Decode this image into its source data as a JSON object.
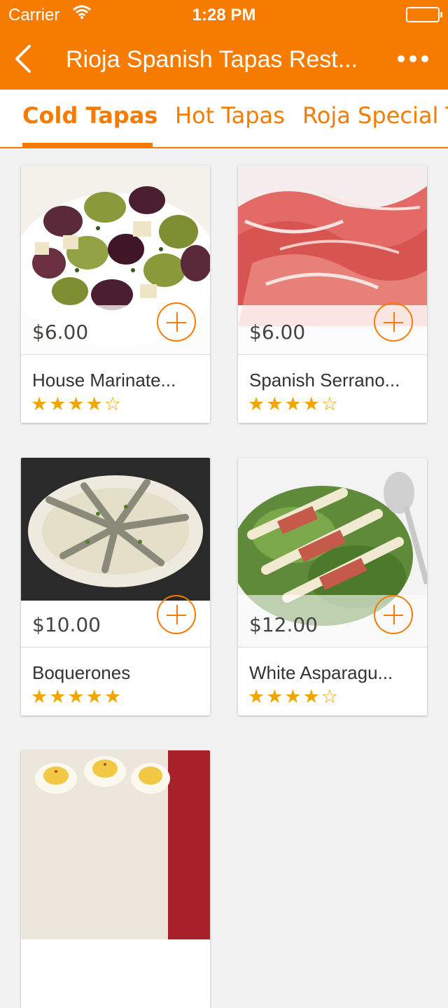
{
  "status_bar": {
    "carrier": "Carrier",
    "time": "1:28 PM"
  },
  "nav": {
    "title": "Rioja Spanish Tapas Rest..."
  },
  "tabs": [
    {
      "label": "Cold Tapas",
      "active": true
    },
    {
      "label": "Hot Tapas",
      "active": false
    },
    {
      "label": "Roja Special T",
      "active": false
    }
  ],
  "items": [
    {
      "price": "$6.00",
      "name": "House Marinate...",
      "rating": 4,
      "stars": "★★★★☆",
      "image": "marinated-olives"
    },
    {
      "price": "$6.00",
      "name": "Spanish Serrano...",
      "rating": 4,
      "stars": "★★★★☆",
      "image": "serrano-ham"
    },
    {
      "price": "$10.00",
      "name": "Boquerones",
      "rating": 5,
      "stars": "★★★★★",
      "image": "anchovies-plate"
    },
    {
      "price": "$12.00",
      "name": "White Asparagu...",
      "rating": 4,
      "stars": "★★★★☆",
      "image": "asparagus-ham"
    },
    {
      "image": "deviled-eggs"
    }
  ],
  "colors": {
    "accent": "#f57c00",
    "star": "#f0a500"
  }
}
